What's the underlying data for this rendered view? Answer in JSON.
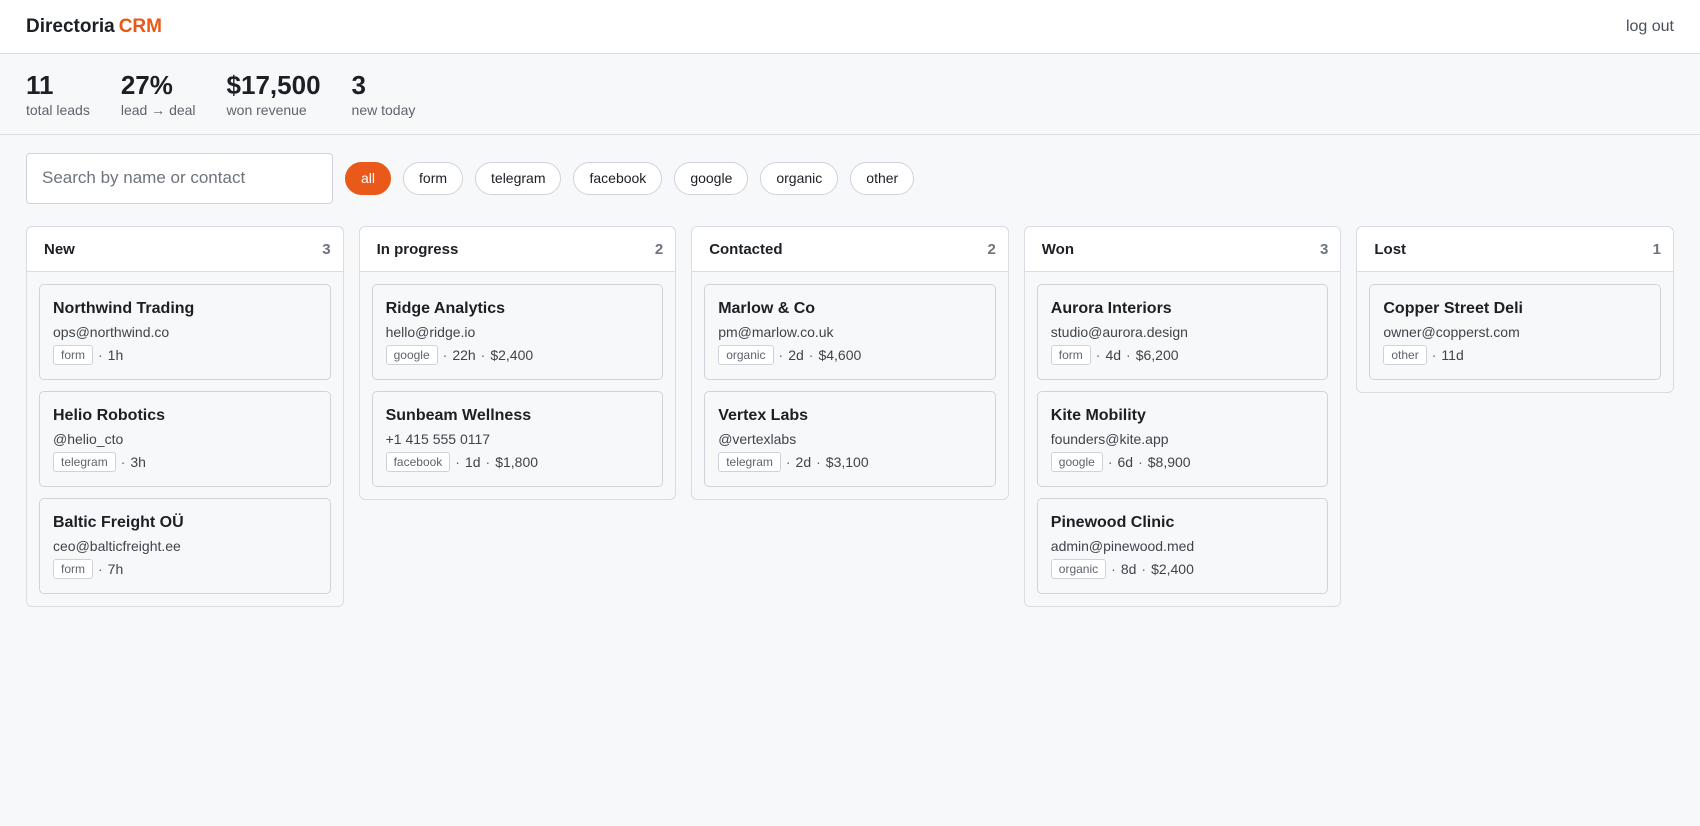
{
  "header": {
    "brand": "Directoria",
    "brand_accent": "CRM",
    "logout": "log out"
  },
  "stats": [
    {
      "value": "11",
      "label": "total leads"
    },
    {
      "value": "27%",
      "label": "lead → deal"
    },
    {
      "value": "$17,500",
      "label": "won revenue"
    },
    {
      "value": "3",
      "label": "new today"
    }
  ],
  "search": {
    "placeholder": "Search by name or contact",
    "value": ""
  },
  "filters": [
    "all",
    "form",
    "telegram",
    "facebook",
    "google",
    "organic",
    "other"
  ],
  "active_filter": "all",
  "colors": {
    "accent": "#e8591a"
  },
  "columns": [
    {
      "title": "New",
      "count": "3",
      "cards": [
        {
          "name": "Northwind Trading",
          "contact": "ops@northwind.co",
          "source": "form",
          "age": "1h",
          "amount": ""
        },
        {
          "name": "Helio Robotics",
          "contact": "@helio_cto",
          "source": "telegram",
          "age": "3h",
          "amount": ""
        },
        {
          "name": "Baltic Freight OÜ",
          "contact": "ceo@balticfreight.ee",
          "source": "form",
          "age": "7h",
          "amount": ""
        }
      ]
    },
    {
      "title": "In progress",
      "count": "2",
      "cards": [
        {
          "name": "Ridge Analytics",
          "contact": "hello@ridge.io",
          "source": "google",
          "age": "22h",
          "amount": "$2,400"
        },
        {
          "name": "Sunbeam Wellness",
          "contact": "+1 415 555 0117",
          "source": "facebook",
          "age": "1d",
          "amount": "$1,800"
        }
      ]
    },
    {
      "title": "Contacted",
      "count": "2",
      "cards": [
        {
          "name": "Marlow & Co",
          "contact": "pm@marlow.co.uk",
          "source": "organic",
          "age": "2d",
          "amount": "$4,600"
        },
        {
          "name": "Vertex Labs",
          "contact": "@vertexlabs",
          "source": "telegram",
          "age": "2d",
          "amount": "$3,100"
        }
      ]
    },
    {
      "title": "Won",
      "count": "3",
      "cards": [
        {
          "name": "Aurora Interiors",
          "contact": "studio@aurora.design",
          "source": "form",
          "age": "4d",
          "amount": "$6,200"
        },
        {
          "name": "Kite Mobility",
          "contact": "founders@kite.app",
          "source": "google",
          "age": "6d",
          "amount": "$8,900"
        },
        {
          "name": "Pinewood Clinic",
          "contact": "admin@pinewood.med",
          "source": "organic",
          "age": "8d",
          "amount": "$2,400"
        }
      ]
    },
    {
      "title": "Lost",
      "count": "1",
      "cards": [
        {
          "name": "Copper Street Deli",
          "contact": "owner@copperst.com",
          "source": "other",
          "age": "11d",
          "amount": ""
        }
      ]
    }
  ]
}
